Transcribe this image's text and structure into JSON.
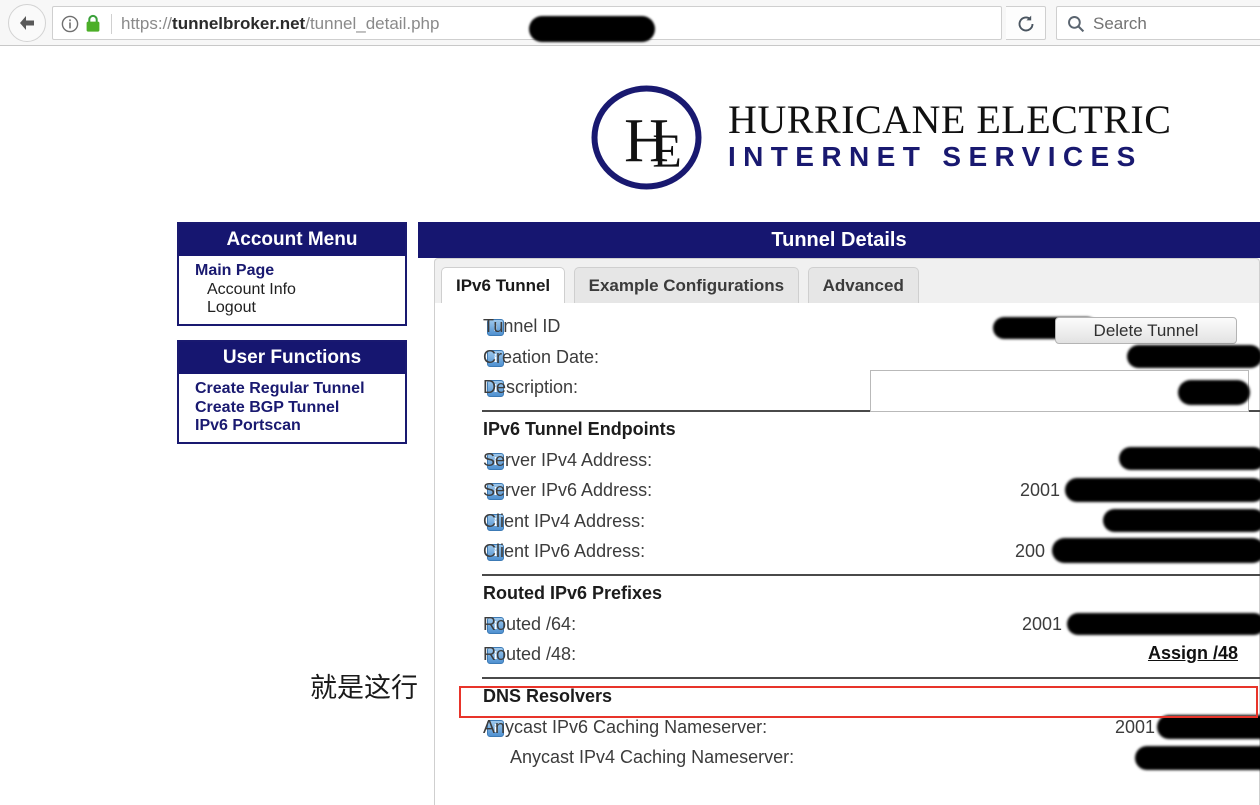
{
  "browser": {
    "url_scheme": "https://",
    "url_host": "tunnelbroker.net",
    "url_path": "/tunnel_detail.php",
    "search_placeholder": "Search",
    "back_icon": "back-arrow-icon",
    "identity_icon": "info-circle-icon",
    "lock_icon": "padlock-icon",
    "reload_icon": "reload-icon",
    "search_icon": "search-icon"
  },
  "logo": {
    "monogram": "HE",
    "line1": "HURRICANE ELECTRIC",
    "line2": "INTERNET SERVICES",
    "navy": "#191970"
  },
  "sidebar": {
    "account_menu": {
      "title": "Account Menu",
      "links": [
        "Main Page"
      ],
      "plain": [
        "Account Info",
        "Logout"
      ]
    },
    "user_functions": {
      "title": "User Functions",
      "links": [
        "Create Regular Tunnel",
        "Create BGP Tunnel",
        "IPv6 Portscan"
      ]
    }
  },
  "main": {
    "title": "Tunnel Details",
    "tabs": [
      {
        "label": "IPv6 Tunnel",
        "active": true
      },
      {
        "label": "Example Configurations",
        "active": false
      },
      {
        "label": "Advanced",
        "active": false
      }
    ],
    "delete_button": "Delete Tunnel",
    "assign_link": "Assign /48",
    "description_value": "",
    "rows": [
      {
        "label": "Tunnel ID",
        "icon": true,
        "value": ""
      },
      {
        "label": "Creation Date:",
        "icon": true,
        "value": ""
      },
      {
        "label": "Description:",
        "icon": true,
        "value": ""
      }
    ],
    "endpoints_heading": "IPv6 Tunnel Endpoints",
    "endpoint_rows": [
      {
        "label": "Server IPv4 Address:",
        "icon": true,
        "value_prefix": ""
      },
      {
        "label": "Server IPv6 Address:",
        "icon": true,
        "value_prefix": "2001"
      },
      {
        "label": "Client IPv4 Address:",
        "icon": true,
        "value_prefix": ""
      },
      {
        "label": "Client IPv6 Address:",
        "icon": true,
        "value_prefix": "200"
      }
    ],
    "prefixes_heading": "Routed IPv6 Prefixes",
    "prefix_rows": [
      {
        "label": "Routed /64:",
        "icon": true,
        "value_prefix": "2001"
      },
      {
        "label": "Routed /48:",
        "icon": true,
        "value_prefix": ""
      }
    ],
    "dns_heading": "DNS Resolvers",
    "dns_rows": [
      {
        "label": "Anycast IPv6 Caching Nameserver:",
        "icon": true,
        "value_prefix": "2001"
      },
      {
        "label": "Anycast IPv4 Caching Nameserver:",
        "icon": false,
        "value_prefix": ""
      }
    ]
  },
  "annotations": {
    "note_text": "就是这行",
    "highlight_color": "#e8342a"
  }
}
